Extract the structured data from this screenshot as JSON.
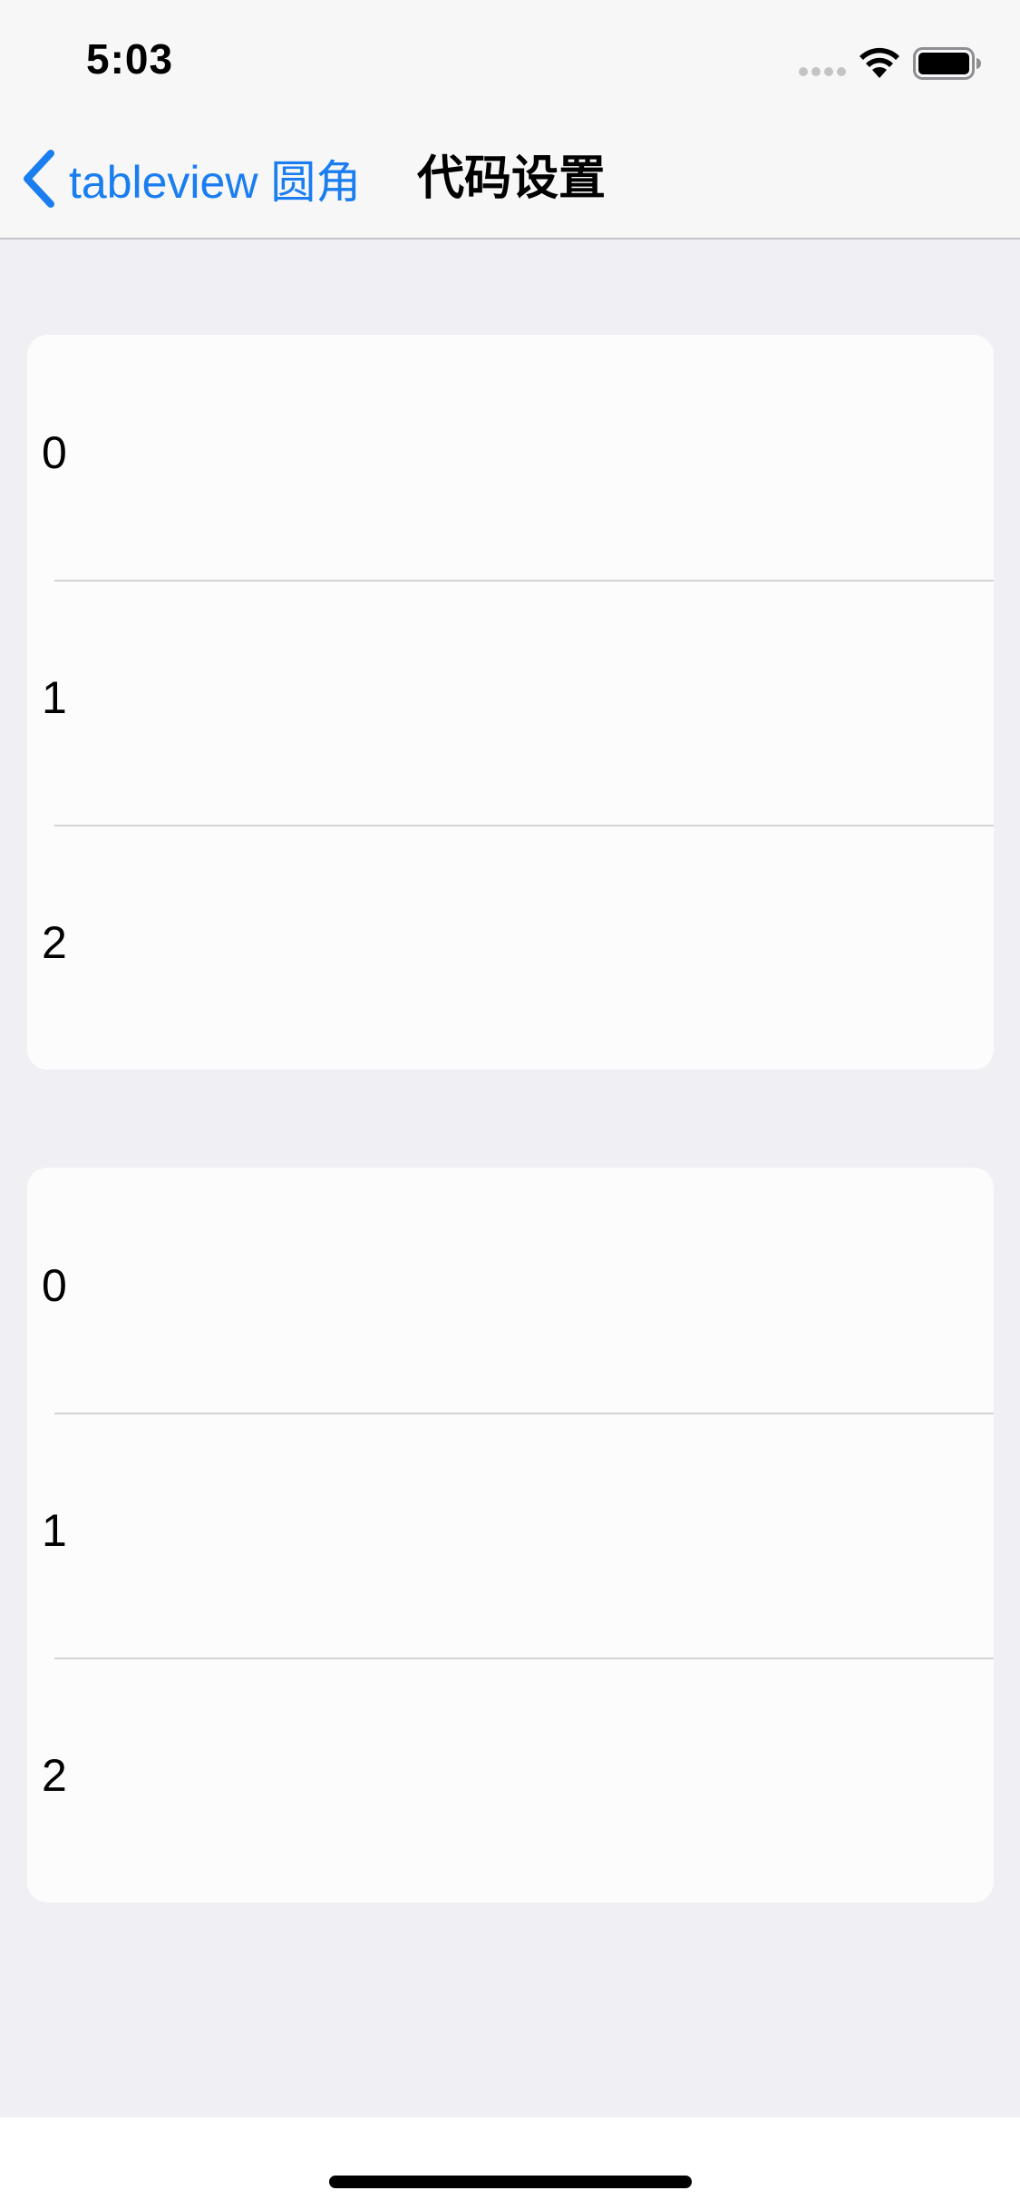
{
  "status_bar": {
    "time": "5:03",
    "icons": [
      "cellular-signal-icon",
      "wifi-icon",
      "battery-icon"
    ]
  },
  "nav_bar": {
    "back_label": "tableview 圆角",
    "title": "代码设置"
  },
  "sections": [
    {
      "rows": [
        "0",
        "1",
        "2"
      ]
    },
    {
      "rows": [
        "0",
        "1",
        "2"
      ]
    }
  ],
  "colors": {
    "accent": "#1a7df0",
    "background": "#efeff4",
    "cell_background": "#fcfcfc",
    "separator": "#d4d4d6"
  }
}
